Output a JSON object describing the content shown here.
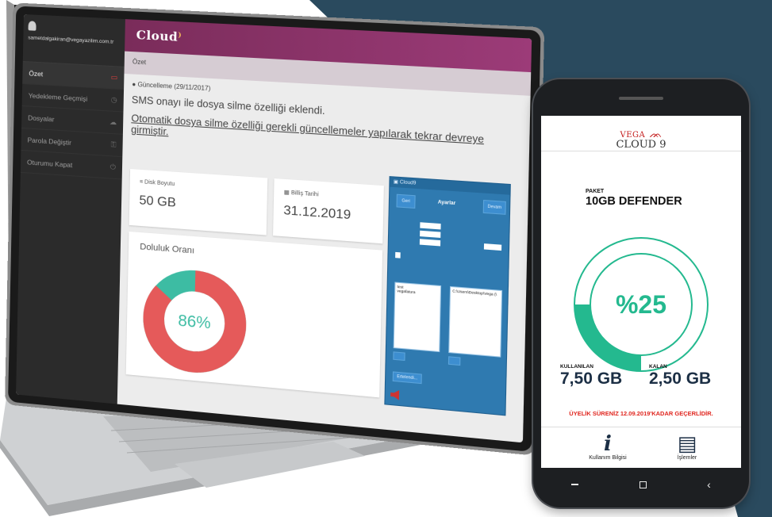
{
  "colors": {
    "navy_bg": "#2a4a5e",
    "topbar": "#8c3670",
    "donut_red": "#e55a5a",
    "donut_teal": "#3dbca3",
    "ring_teal": "#24b98f",
    "warning_red": "#e0261f",
    "dialog_blue": "#2f7ab0"
  },
  "laptop": {
    "brand": "Cloud",
    "user_email": "sametdalgakiran@vegayazilim.com.tr",
    "sidebar": [
      {
        "label": "Özet",
        "icon": "monitor-icon"
      },
      {
        "label": "Yedekleme Geçmişi",
        "icon": "history-icon"
      },
      {
        "label": "Dosyalar",
        "icon": "cloud-icon"
      },
      {
        "label": "Parola Değiştir",
        "icon": "key-icon"
      },
      {
        "label": "Oturumu Kapat",
        "icon": "logout-icon"
      }
    ],
    "breadcrumb": "Özet",
    "update_title": "Güncelleme (29/11/2017)",
    "update_line1": "SMS onayı ile dosya silme özelliği eklendi.",
    "update_line2": "Otomatik dosya silme özelliği gerekli güncellemeler yapılarak tekrar devreye girmiştir.",
    "disk_label": "Disk Boyutu",
    "disk_value": "50 GB",
    "billing_label": "Billiş Tarihi",
    "billing_value": "31.12.2019",
    "fullness_title": "Doluluk Oranı",
    "fullness_percent": 86,
    "fullness_text": "86%",
    "dialog": {
      "title": "Cloud9",
      "heading": "Ayarlar",
      "btn_left": "Geri",
      "btn_right": "Devam",
      "btn_bottom": "Ertelendi...",
      "list1": [
        "test",
        "vegafatura"
      ],
      "list2": [
        "C:\\Users\\Desktop\\Vega (\\"
      ]
    }
  },
  "phone": {
    "logo_top": "VEGA",
    "logo_bottom": "CLOUD 9",
    "package_label": "PAKET",
    "package_name": "10GB DEFENDER",
    "usage_percent": 25,
    "usage_text": "%25",
    "used_label": "KULLANILAN",
    "used_value": "7,50 GB",
    "left_label": "KALAN",
    "left_value": "2,50 GB",
    "membership": "ÜYELİK SÜRENİZ 12.09.2019'KADAR GEÇERLİDİR.",
    "tabs": [
      {
        "label": "Kullanım Bilgisi",
        "icon": "info-icon"
      },
      {
        "label": "İşlemler",
        "icon": "operations-icon"
      }
    ]
  }
}
